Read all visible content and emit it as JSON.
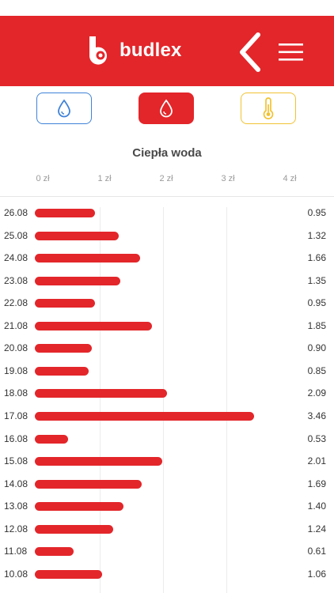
{
  "header": {
    "brand": "budlex",
    "colors": {
      "header_bg": "#e3262a",
      "cold": "#3f82d8",
      "hot": "#e3262a",
      "heat": "#f1c232"
    }
  },
  "tabs": [
    {
      "icon": "water-drop-icon",
      "state": "inactive",
      "color": "#3f82d8"
    },
    {
      "icon": "water-drop-icon",
      "state": "active",
      "color": "#e3262a"
    },
    {
      "icon": "thermometer-icon",
      "state": "inactive",
      "color": "#f1c232"
    }
  ],
  "chart_title": "Ciepła woda",
  "chart_data": {
    "type": "bar",
    "orientation": "horizontal",
    "title": "Ciepła woda",
    "axis_ticks": [
      "0 zł",
      "1 zł",
      "2 zł",
      "3 zł",
      "4 zł"
    ],
    "xlim": [
      0,
      4
    ],
    "categories": [
      "26.08",
      "25.08",
      "24.08",
      "23.08",
      "22.08",
      "21.08",
      "20.08",
      "19.08",
      "18.08",
      "17.08",
      "16.08",
      "15.08",
      "14.08",
      "13.08",
      "12.08",
      "11.08",
      "10.08"
    ],
    "values": [
      0.95,
      1.32,
      1.66,
      1.35,
      0.95,
      1.85,
      0.9,
      0.85,
      2.09,
      3.46,
      0.53,
      2.01,
      1.69,
      1.4,
      1.24,
      0.61,
      1.06
    ],
    "labels": [
      "0.95",
      "1.32",
      "1.66",
      "1.35",
      "0.95",
      "1.85",
      "0.90",
      "0.85",
      "2.09",
      "3.46",
      "0.53",
      "2.01",
      "1.69",
      "1.40",
      "1.24",
      "0.61",
      "1.06"
    ],
    "bar_color": "#e3262a",
    "grid": true
  }
}
